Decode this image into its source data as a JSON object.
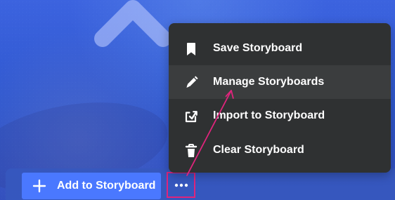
{
  "bottom_bar": {
    "add_button_label": "Add to Storyboard",
    "plus_icon": "plus-icon",
    "more_icon": "more-horizontal-icon",
    "more_highlight_color": "#e0247c"
  },
  "menu": {
    "items": [
      {
        "label": "Save Storyboard",
        "icon": "bookmark-icon"
      },
      {
        "label": "Manage Storyboards",
        "icon": "pencil-icon"
      },
      {
        "label": "Import to Storyboard",
        "icon": "import-icon"
      },
      {
        "label": "Clear Storyboard",
        "icon": "trash-icon"
      }
    ]
  },
  "colors": {
    "background_blue": "#3a61df",
    "menu_background": "#2f3132",
    "button_blue": "#4a78ff",
    "annotation_pink": "#e0247c"
  }
}
